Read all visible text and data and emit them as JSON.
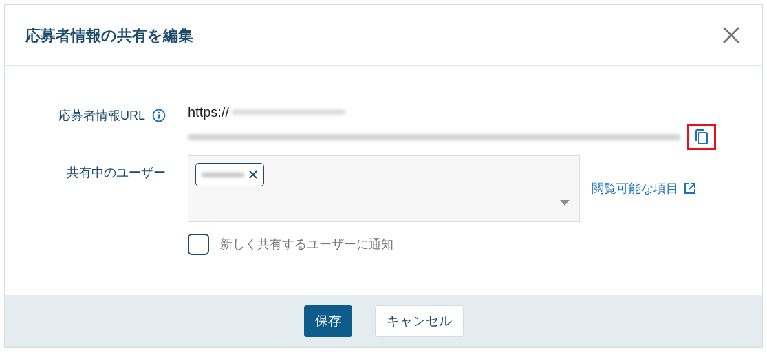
{
  "dialog": {
    "title": "応募者情報の共有を編集"
  },
  "url_field": {
    "label": "応募者情報URL",
    "value": "https://",
    "copy_highlighted": true
  },
  "shared_users": {
    "label": "共有中のユーザー",
    "tags": [
      {
        "kind": "redacted"
      }
    ]
  },
  "viewable_items_link": "閲覧可能な項目",
  "notify": {
    "label": "新しく共有するユーザーに通知",
    "checked": false
  },
  "buttons": [
    {
      "label": "保存",
      "kind": "primary"
    },
    {
      "label": "キャンセル",
      "kind": "secondary"
    }
  ]
}
